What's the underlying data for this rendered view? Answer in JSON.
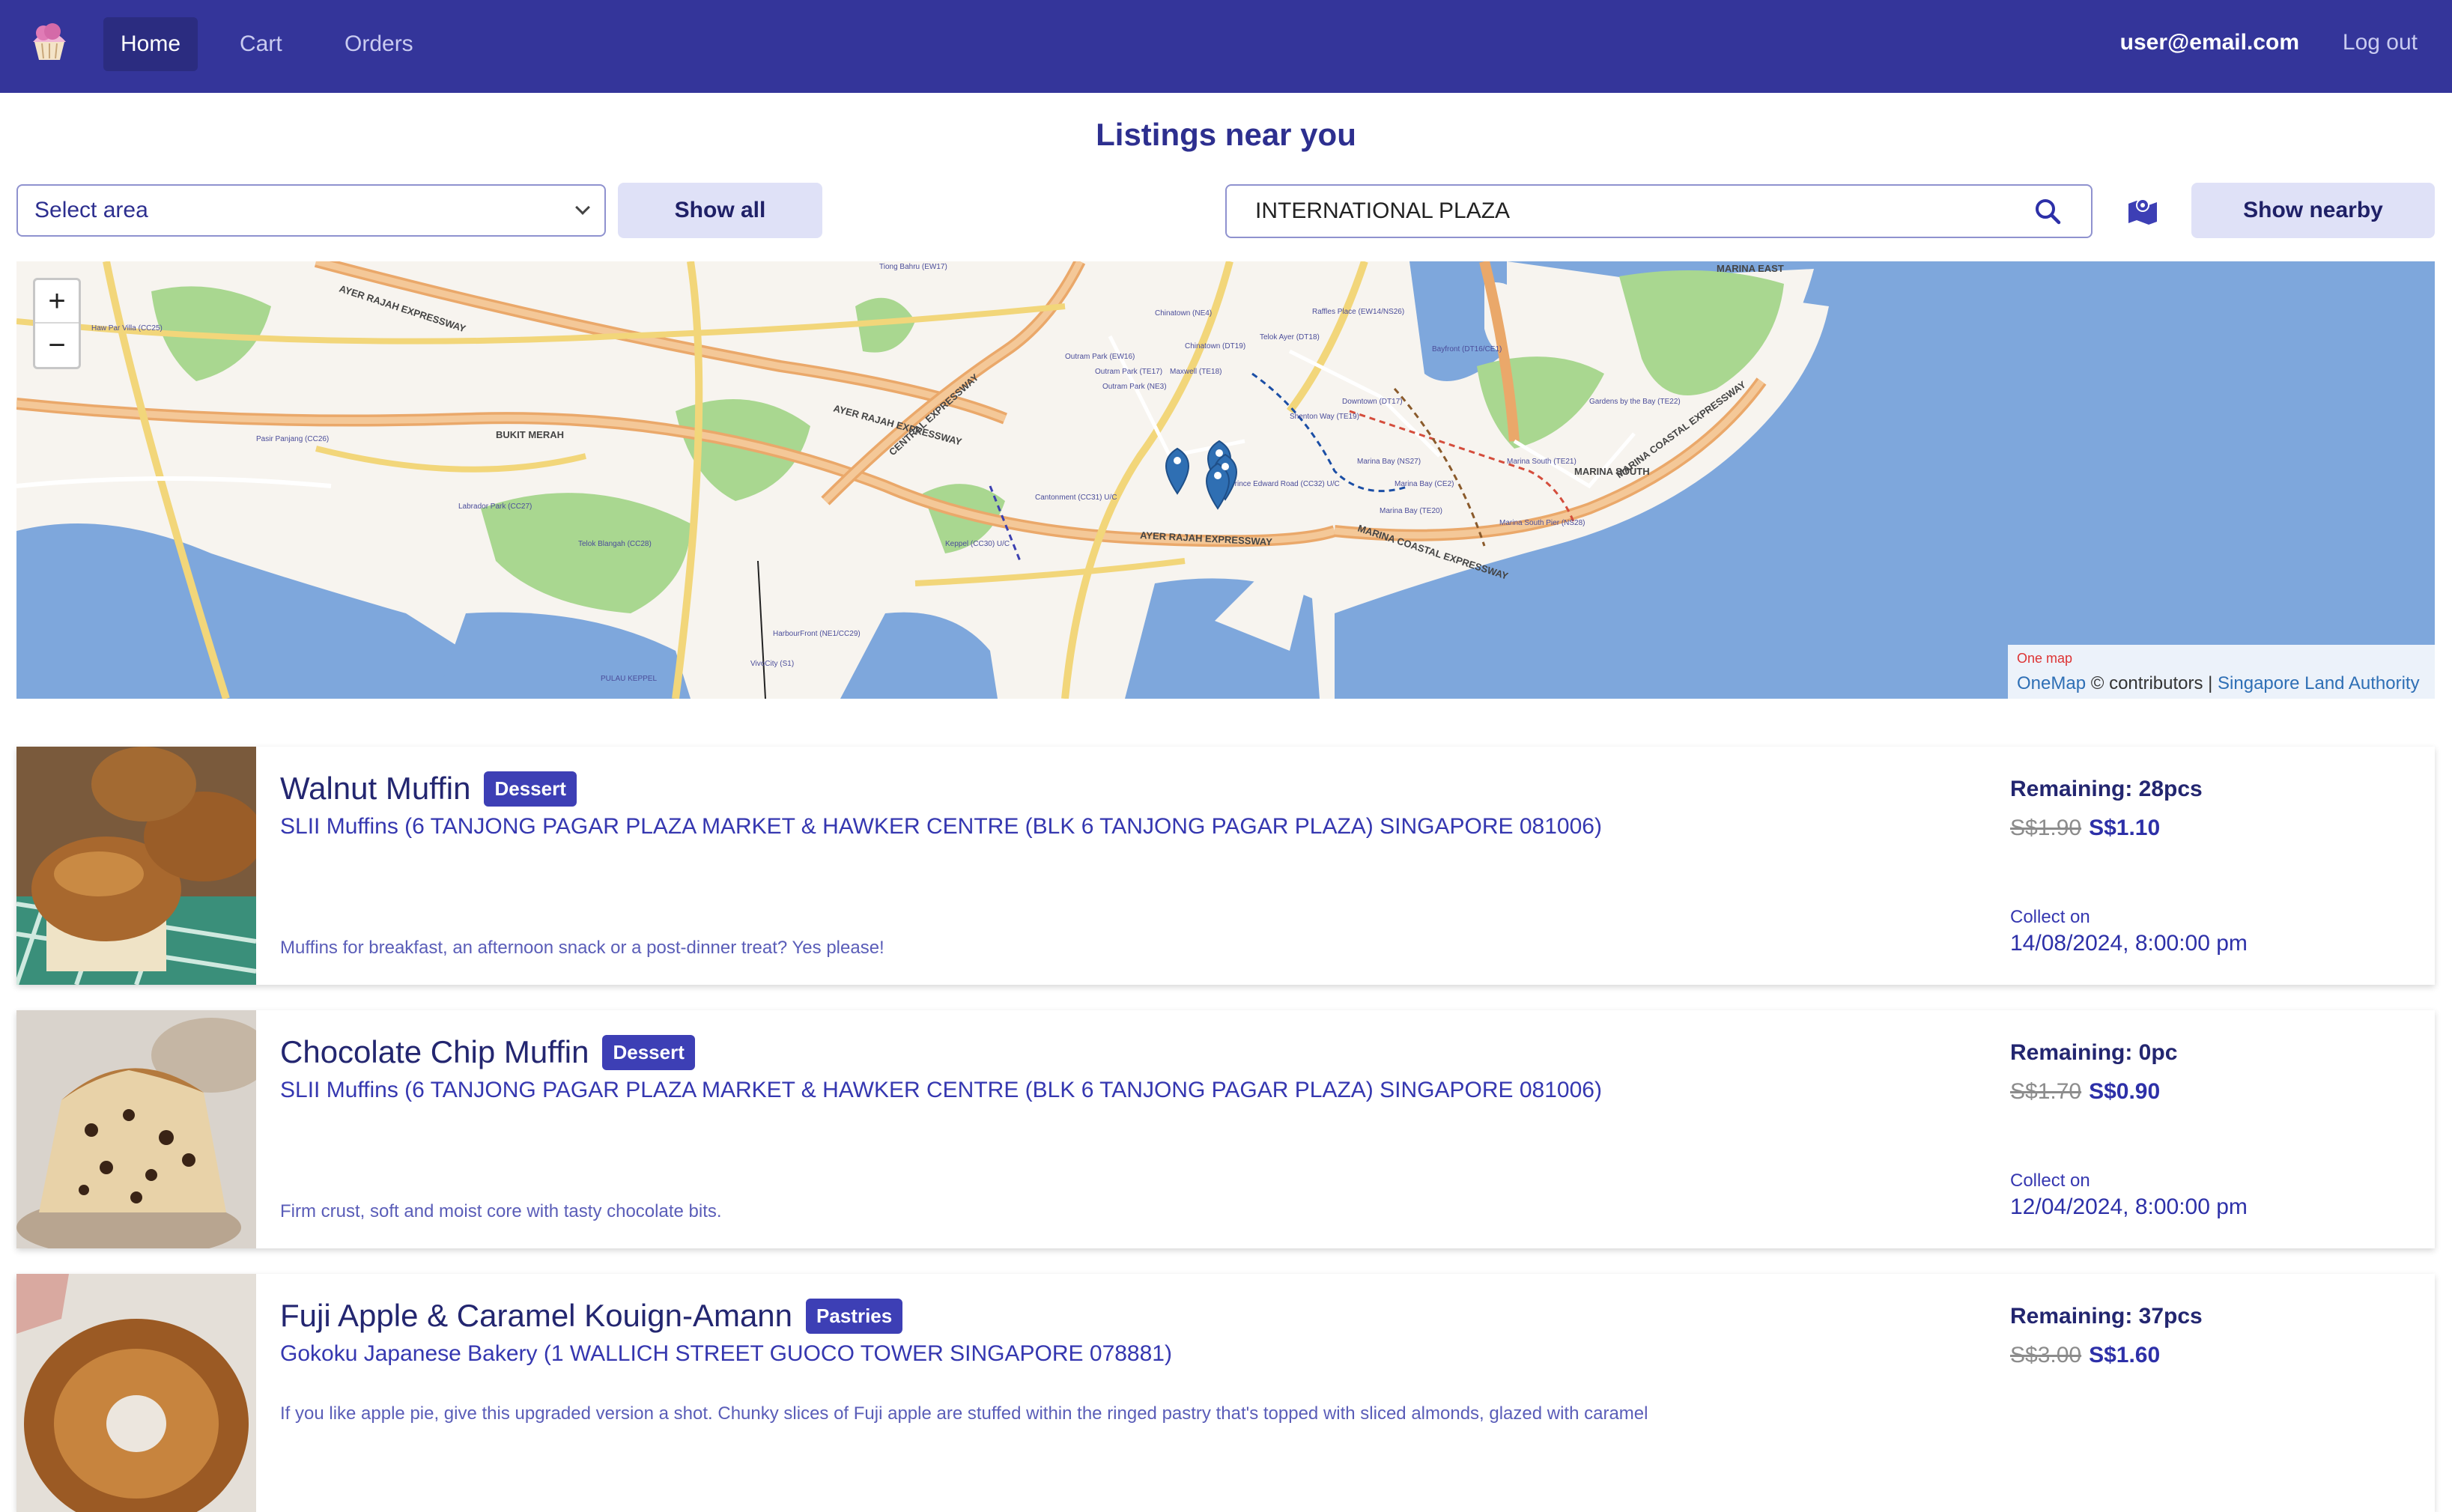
{
  "nav": {
    "home": "Home",
    "cart": "Cart",
    "orders": "Orders",
    "user_email": "user@email.com",
    "logout": "Log out"
  },
  "page_title": "Listings near you",
  "filters": {
    "area_select_value": "Select area",
    "show_all_label": "Show all",
    "search_value": "INTERNATIONAL PLAZA",
    "show_nearby_label": "Show nearby"
  },
  "map": {
    "zoom_in": "+",
    "zoom_out": "−",
    "attribution_logo": "One map",
    "attribution_link1": "OneMap",
    "attribution_mid": " © contributors | ",
    "attribution_link2": "Singapore Land Authority",
    "labels": [
      "AYER RAJAH EXPRESSWAY",
      "AYER RAJAH EXPRESSWAY",
      "AYER RAJAH EXPRESSWAY",
      "CENTRAL EXPRESSWAY",
      "MARINA COASTAL EXPRESSWAY",
      "MARINA COASTAL EXPRESSWAY",
      "BUKIT MERAH",
      "MARINA SOUTH",
      "MARINA EAST",
      "Tiong Bahru (EW17)",
      "Chinatown (NE4)",
      "Chinatown (DT19)",
      "Telok Ayer (DT18)",
      "Raffles Place (EW14/NS26)",
      "Bayfront (DT16/CE1)",
      "Outram Park (EW16)",
      "Outram Park (TE17)",
      "Outram Park (NE3)",
      "Maxwell (TE18)",
      "Downtown (DT17)",
      "Shenton Way (TE19)",
      "Marina Bay (NS27)",
      "Marina Bay (CE2)",
      "Marina Bay (TE20)",
      "Gardens by the Bay (TE22)",
      "Marina South (TE21)",
      "Marina South Pier (NS28)",
      "Cantonment (CC31) U/C",
      "Prince Edward Road (CC32) U/C",
      "Keppel (CC30) U/C",
      "Pasir Panjang (CC26)",
      "Haw Par Villa (CC25)",
      "Labrador Park (CC27)",
      "Telok Blangah (CC28)",
      "HarbourFront (NE1/CC29)",
      "VivoCity (S1)",
      "PULAU KEPPEL"
    ]
  },
  "listings": [
    {
      "name": "Walnut Muffin",
      "category": "Dessert",
      "store": "SLII Muffins (6 TANJONG PAGAR PLAZA MARKET & HAWKER CENTRE (BLK 6 TANJONG PAGAR PLAZA) SINGAPORE 081006)",
      "description": "Muffins for breakfast, an afternoon snack or a post-dinner treat? Yes please!",
      "remaining": "Remaining: 28pcs",
      "old_price": "S$1.90",
      "new_price": "S$1.10",
      "collect_label": "Collect on",
      "collect_date": "14/08/2024, 8:00:00 pm"
    },
    {
      "name": "Chocolate Chip Muffin",
      "category": "Dessert",
      "store": "SLII Muffins (6 TANJONG PAGAR PLAZA MARKET & HAWKER CENTRE (BLK 6 TANJONG PAGAR PLAZA) SINGAPORE 081006)",
      "description": "Firm crust, soft and moist core with tasty chocolate bits.",
      "remaining": "Remaining: 0pc",
      "old_price": "S$1.70",
      "new_price": "S$0.90",
      "collect_label": "Collect on",
      "collect_date": "12/04/2024, 8:00:00 pm"
    },
    {
      "name": "Fuji Apple & Caramel Kouign-Amann",
      "category": "Pastries",
      "store": "Gokoku Japanese Bakery (1 WALLICH STREET GUOCO TOWER SINGAPORE 078881)",
      "description": "If you like apple pie, give this upgraded version a shot. Chunky slices of Fuji apple are stuffed within the ringed pastry that's topped with sliced almonds, glazed with caramel",
      "remaining": "Remaining: 37pcs",
      "old_price": "S$3.00",
      "new_price": "S$1.60"
    }
  ],
  "colors": {
    "navbar": "#34359a",
    "accent": "#3d3fb5",
    "text": "#2d2f8f",
    "button_bg": "#dfe1f7",
    "sea": "#7ea7dc",
    "park": "#a9d790"
  },
  "icons": {
    "logo": "cupcake-logo",
    "search": "search-icon",
    "map_button": "map-icon",
    "marker": "map-marker-icon"
  }
}
